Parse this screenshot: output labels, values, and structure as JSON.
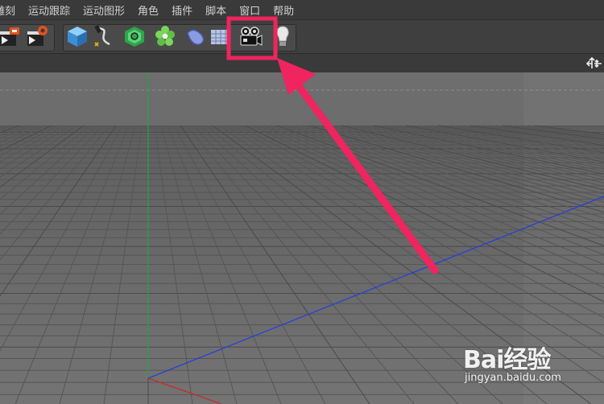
{
  "menu": {
    "items": [
      "雕刻",
      "运动跟踪",
      "运动图形",
      "角色",
      "插件",
      "脚本",
      "窗口",
      "帮助"
    ]
  },
  "toolbar": {
    "buttons": [
      "render-region-icon",
      "render-settings-icon",
      "cube-icon",
      "pen-spline-icon",
      "subdivision-icon",
      "cloner-icon",
      "deformer-icon",
      "floor-grid-icon",
      "camera-icon",
      "light-icon"
    ],
    "highlighted_button": "camera-icon"
  },
  "annotation": {
    "highlight_color": "#f0245f"
  },
  "viewport": {
    "background": "#6a6a6a",
    "y_axis_color": "#1fa83a",
    "x_axis_color": "#c62a2a",
    "z_axis_color": "#2a3fd6"
  },
  "watermark": {
    "brand": "Bai经验",
    "url": "jingyan.baidu.com"
  }
}
